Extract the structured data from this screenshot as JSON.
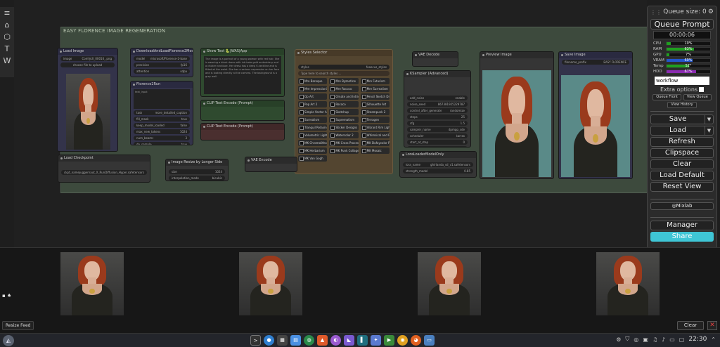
{
  "toolbar": {
    "items": [
      "≡",
      "⌂",
      "⬡",
      "T",
      "W"
    ]
  },
  "group": {
    "title": "EASY FLORENCE IMAGE REGENERATION"
  },
  "nodes": {
    "load_image": {
      "title": "Load Image",
      "image_field": "image",
      "image_value": "ComfyUI_00016_.png",
      "upload": "choose file to upload"
    },
    "downloader": {
      "title": "DownloadAndLoadFlorence2Model",
      "rows": [
        [
          "model",
          "microsoft/Florence-2-base"
        ],
        [
          "precision",
          "fp16"
        ],
        [
          "attention",
          "sdpa"
        ]
      ]
    },
    "florence_run": {
      "title": "Florence2Run",
      "text_input": "text_input",
      "rows": [
        [
          "task",
          "more_detailed_caption"
        ],
        [
          "fill_mask",
          "true"
        ],
        [
          "keep_model_loaded",
          "false"
        ],
        [
          "max_new_tokens",
          "1024"
        ],
        [
          "num_beams",
          "3"
        ],
        [
          "do_sample",
          "true"
        ],
        [
          "output_mask_select",
          ""
        ]
      ]
    },
    "show_text": {
      "title": "Show Text 🐍|WAS|App",
      "text": "The image is a portrait of a young woman with red hair. She is wearing a black dress with intricate gold embroidery and a choker necklace. Her dress has a deep V-neckline and is fitted at the waist. She has a serious expression on her face and is looking directly at the camera. The background is a gray wall."
    },
    "clip_pos": {
      "title": "CLIP Text Encode (Prompt)"
    },
    "clip_neg": {
      "title": "CLIP Text Encode (Prompt)"
    },
    "styles": {
      "title": "Styles Selector",
      "style_field": "styles",
      "style_value": "fooocus_styles",
      "search_placeholder": "Type here to search styles ...",
      "options": [
        "Mre Baroque",
        "Mre Byzantine",
        "Mre Futurism",
        "Mre Impressionism",
        "Mre Rococo",
        "Mre Surrealism",
        "Op Art",
        "Ornate and Intricate",
        "Pencil Sketch Drawing",
        "Pop Art 2",
        "Rococo",
        "Silhouette Art",
        "Simple Vector Art",
        "Sketchup",
        "Steampunk 2",
        "Surrealism",
        "Suprematism",
        "Terragen",
        "Tranquil Relaxing Atmosphere",
        "Sticker Designs",
        "Vibrant Rim Light",
        "Volumetric Lighting",
        "Watercolor 2",
        "Whimsical and Playful",
        "MK Chromolithography",
        "MK Cross Processing Print",
        "MK Dufaycolor Photograph",
        "MK Herbarium",
        "MK Punk Collage",
        "MK Mosaic",
        "MK Van Gogh"
      ]
    },
    "vae_decode": {
      "title": "VAE Decode"
    },
    "ksampler": {
      "title": "KSampler (Advanced)",
      "rows": [
        [
          "add_noise",
          "enable"
        ],
        [
          "noise_seed",
          "867381925229787"
        ],
        [
          "control_after_generate",
          "randomize"
        ],
        [
          "steps",
          "25"
        ],
        [
          "cfg",
          "1.5"
        ],
        [
          "sampler_name",
          "dpmpp_sde"
        ],
        [
          "scheduler",
          "karras"
        ],
        [
          "start_at_step",
          "0"
        ],
        [
          "end_at_step",
          "10000"
        ],
        [
          "return_with_leftover_noise",
          "disable"
        ]
      ]
    },
    "load_ckpt": {
      "title": "Load Checkpoint",
      "rows": [
        [
          "ckpt_name",
          "juggernaut_X_RunDiffusion_Hyper.safetensors"
        ]
      ]
    },
    "resize": {
      "title": "Image Resize by Longer Side",
      "rows": [
        [
          "size",
          "1024"
        ],
        [
          "interpolation_mode",
          "bicubic"
        ]
      ]
    },
    "vae_encode": {
      "title": "VAE Encode"
    },
    "lora": {
      "title": "LoraLoaderModelOnly",
      "rows": [
        [
          "lora_name",
          "ghirlanda_sd_v1.safetensors"
        ],
        [
          "strength_model",
          "0.85"
        ]
      ]
    },
    "preview": {
      "title": "Preview Image"
    },
    "save": {
      "title": "Save Image",
      "rows": [
        [
          "filename_prefix",
          "EASY FLORENCE"
        ]
      ]
    }
  },
  "queue": {
    "title": "Queue size: 0",
    "queue_prompt": "Queue Prompt",
    "timer": "00:00:06",
    "meters": [
      {
        "label": "CPU",
        "value": "10%",
        "fraction": 0.1,
        "color": "#1fa01f"
      },
      {
        "label": "RAM",
        "value": "63%",
        "fraction": 0.63,
        "color": "#1fa01f"
      },
      {
        "label": "GPU",
        "value": "7%",
        "fraction": 0.07,
        "color": "#1fa01f"
      },
      {
        "label": "VRAM",
        "value": "60%",
        "fraction": 0.6,
        "color": "#2255cc"
      },
      {
        "label": "Temp",
        "value": "52°",
        "fraction": 0.52,
        "color": "#1fa01f"
      },
      {
        "label": "HDD",
        "value": "67%",
        "fraction": 0.67,
        "color": "#8a2bb0"
      }
    ],
    "workflow_value": "workflow",
    "extra_options": "Extra options",
    "queue_front": "Queue Front",
    "view_queue": "View Queue",
    "view_history": "View History",
    "save": "Save",
    "load": "Load",
    "refresh": "Refresh",
    "clipspace": "Clipspace",
    "clear": "Clear",
    "load_default": "Load Default",
    "reset_view": "Reset View",
    "mixlab": "Mixlab",
    "manager": "Manager",
    "share": "Share"
  },
  "feed": {
    "resize": "Resize Feed",
    "clear": "Clear",
    "close": "✕"
  },
  "taskbar": {
    "clock": "22:30"
  }
}
